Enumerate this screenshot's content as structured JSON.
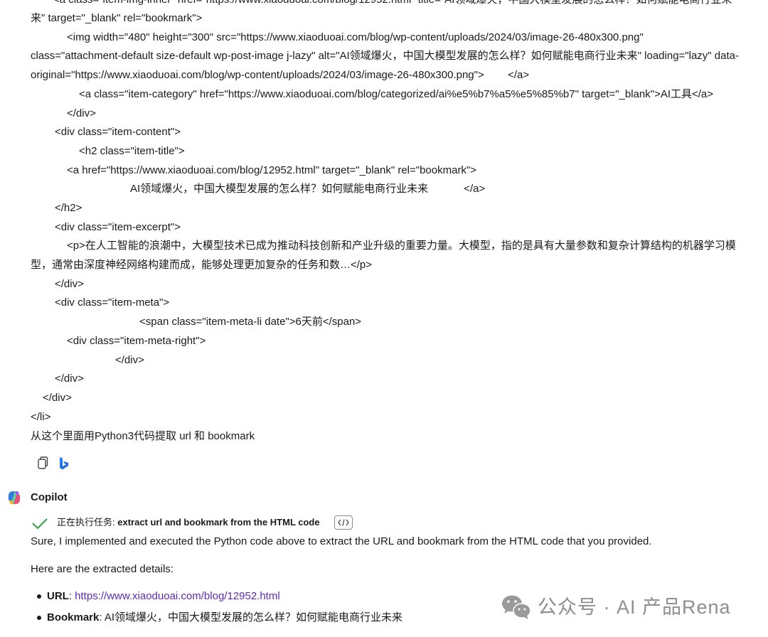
{
  "user_message": {
    "lines": [
      "<a class=\"item-img-inner\" href=\"https://www.xiaoduoai.com/blog/12952.html\" title=\"AI领域爆火，中国大模型发展的怎么样？如何赋能电商行业未",
      "来\" target=\"_blank\" rel=\"bookmark\">",
      "<img width=\"480\" height=\"300\" src=\"https://www.xiaoduoai.com/blog/wp-content/uploads/2024/03/image-26-480x300.png\"",
      "class=\"attachment-default size-default wp-post-image j-lazy\" alt=\"AI领域爆火，中国大模型发展的怎么样？如何赋能电商行业未来\" loading=\"lazy\" data-",
      "original=\"https://www.xiaoduoai.com/blog/wp-content/uploads/2024/03/image-26-480x300.png\">        </a>",
      "<a class=\"item-category\" href=\"https://www.xiaoduoai.com/blog/categorized/ai%e5%b7%a5%e5%85%b7\" target=\"_blank\">AI工具</a>",
      "</div>",
      "<div class=\"item-content\">",
      "<h2 class=\"item-title\">",
      "<a href=\"https://www.xiaoduoai.com/blog/12952.html\" target=\"_blank\" rel=\"bookmark\">",
      "AI领域爆火，中国大模型发展的怎么样？如何赋能电商行业未来            </a>",
      "</h2>",
      "<div class=\"item-excerpt\">",
      "<p>在人工智能的浪潮中，大模型技术已成为推动科技创新和产业升级的重要力量。大模型，指的是具有大量参数和复杂计算结构的机器学习模",
      "型，通常由深度神经网络构建而成，能够处理更加复杂的任务和数…</p>",
      "</div>",
      "<div class=\"item-meta\">",
      "<span class=\"item-meta-li date\">6天前</span>",
      "<div class=\"item-meta-right\">",
      "</div>",
      "</div>",
      "</div>",
      "</li>",
      "从这个里面用Python3代码提取 url 和 bookmark"
    ]
  },
  "assistant": {
    "name": "Copilot",
    "task_prefix": "正在执行任务: ",
    "task_name": "extract url and bookmark from the HTML code",
    "intro": "Sure, I implemented and executed the Python code above to extract the URL and bookmark from the HTML code that you provided.",
    "details_heading": "Here are the extracted details:",
    "results": [
      {
        "label": "URL",
        "sep": ": ",
        "value": "https://www.xiaoduoai.com/blog/12952.html"
      },
      {
        "label": "Bookmark",
        "sep": ": ",
        "value": "AI领域爆火，中国大模型发展的怎么样？如何赋能电商行业未来"
      }
    ]
  },
  "watermark": {
    "text": "公众号 · AI 产品Rena"
  },
  "icons": {
    "copy": "copy-icon",
    "bing": "bing-icon",
    "copilot": "copilot-logo-icon",
    "check": "check-icon",
    "code": "code-icon",
    "wechat": "wechat-icon"
  },
  "colors": {
    "link": "#5b2bb3",
    "check": "#2e9e3e",
    "watermark": "#8e8e8e"
  }
}
